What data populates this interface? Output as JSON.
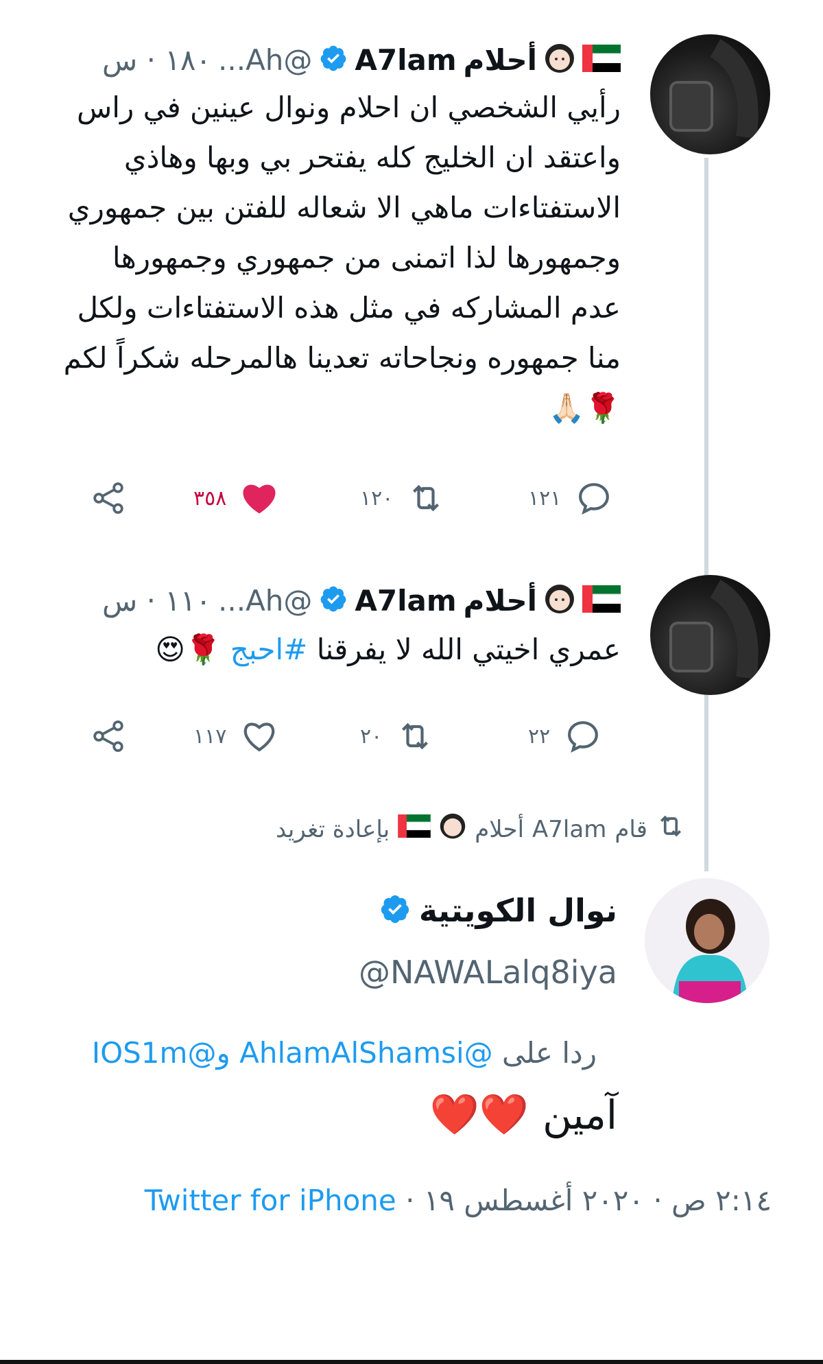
{
  "tweets": [
    {
      "display_name": "أحلام",
      "name_latin": "A7lam",
      "handle": "@Ah...",
      "time": "١٨٠ · س",
      "text_lines": [
        "رأيي الشخصي ان احلام ونوال عينين في راس",
        "واعتقد ان الخليج كله يفتحر بي وبها  وهاذي",
        "الاستفتاءات ماهي الا شعاله للفتن بين جمهوري",
        "وجمهورها لذا اتمنى من جمهوري وجمهورها",
        "عدم المشاركه في مثل هذه الاستفتاءات ولكل",
        "منا جمهوره ونجاحاته تعدينا هالمرحله شكراً لكم"
      ],
      "emoji_line": "🌹🙏🏻",
      "reply_count": "١٢١",
      "retweet_count": "١٢٠",
      "like_count": "٣٥٨",
      "liked": true
    },
    {
      "display_name": "أحلام",
      "name_latin": "A7lam",
      "handle": "@Ah...",
      "time": "١١٠ · س",
      "text": "عمري اخيتي الله لا يفرقنا",
      "hashtag": "#احبج",
      "emoji": "🌹😍",
      "reply_count": "٢٢",
      "retweet_count": "٢٠",
      "like_count": "١١٧",
      "liked": false
    }
  ],
  "retweet_banner": {
    "text_prefix": "قام",
    "name_latin": "A7lam",
    "display_name": "أحلام",
    "text_suffix": "بإعادة تغريد"
  },
  "main_tweet": {
    "display_name": "نوال الكويتية",
    "handle": "@NAWALalq8iya",
    "reply_prefix": "ردا على",
    "reply_to_1": "@AhlamAlShamsi",
    "reply_joiner": "و",
    "reply_to_2": "@IOS1m",
    "text": "آمين",
    "hearts": "❤️❤️",
    "timestamp": "٢:١٤ ص · ٢٠٢٠ أغسطس ١٩ ·",
    "source": "Twitter for iPhone"
  },
  "colors": {
    "link": "#1d9bf0",
    "like_active": "#f91880",
    "text_secondary": "#536471"
  },
  "icons": [
    "verified-badge-icon",
    "uae-flag-icon",
    "girl-emoji-icon",
    "reply-icon",
    "retweet-icon",
    "like-icon",
    "share-icon",
    "chevron-down-icon"
  ]
}
